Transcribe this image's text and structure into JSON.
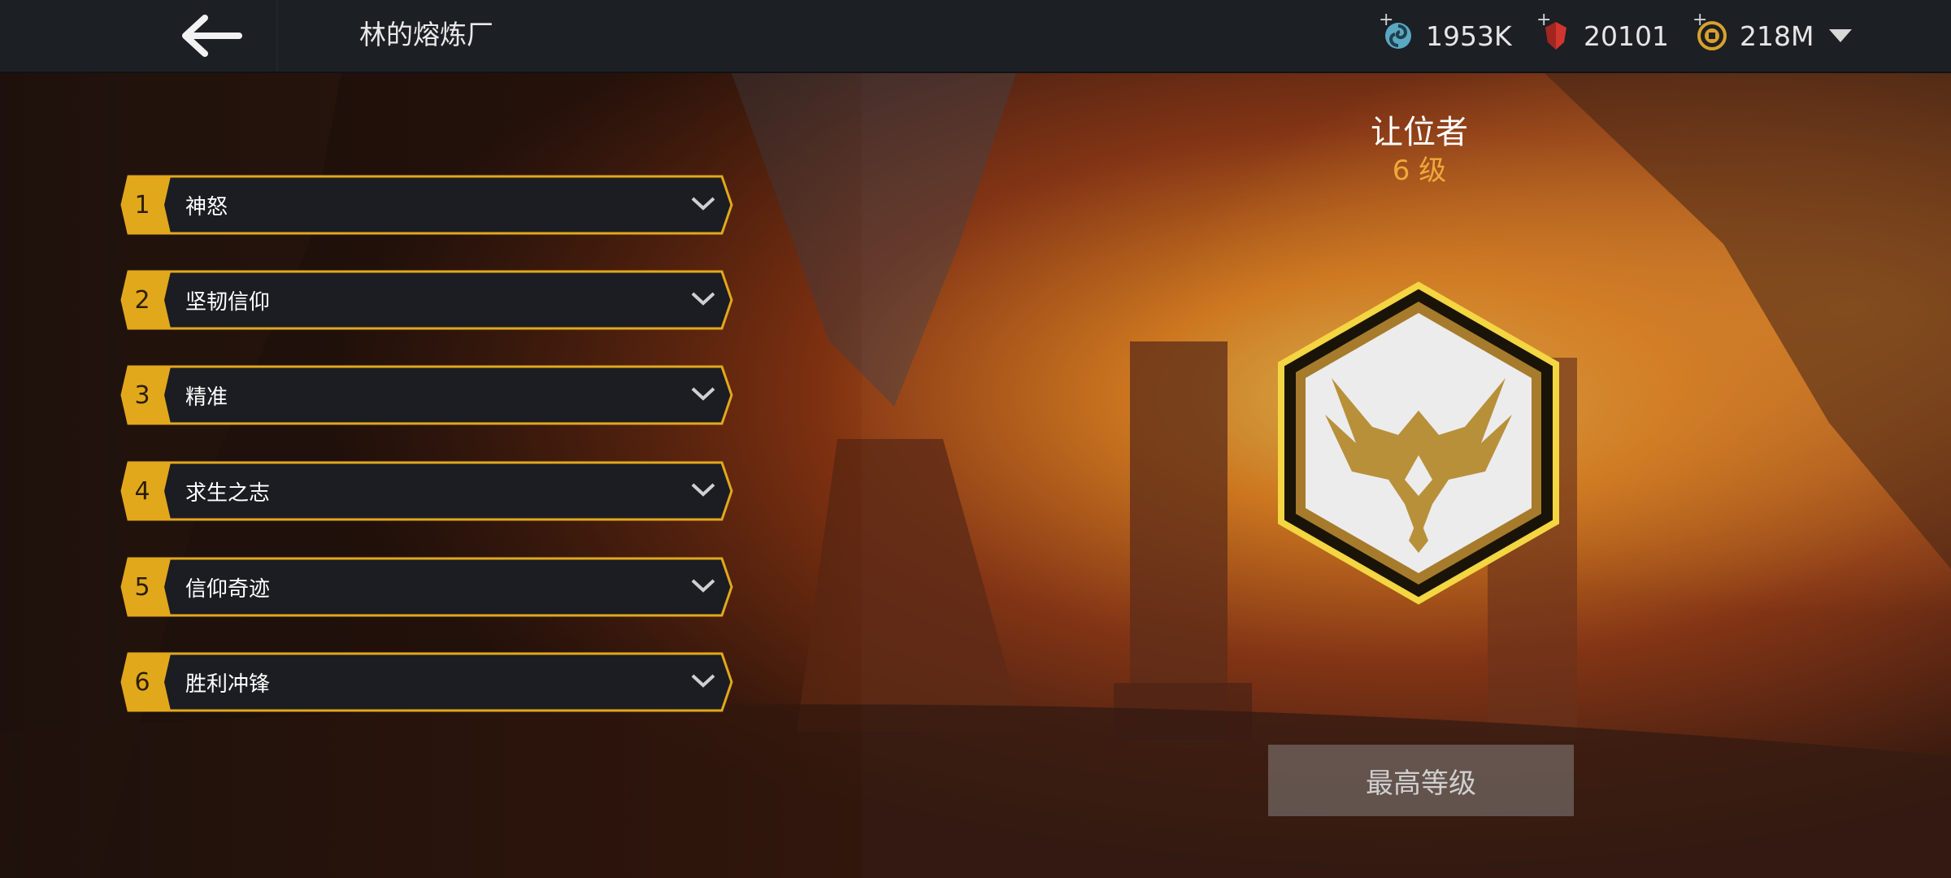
{
  "header": {
    "title": "林的熔炼厂",
    "resources": [
      {
        "icon": "energy-swirl-icon",
        "value": "1953K",
        "plus": "+"
      },
      {
        "icon": "red-gem-icon",
        "value": "20101",
        "plus": "+"
      },
      {
        "icon": "gold-coin-icon",
        "value": "218M",
        "plus": "+"
      }
    ]
  },
  "list": {
    "items": [
      {
        "num": "1",
        "label": "神怒"
      },
      {
        "num": "2",
        "label": "坚韧信仰"
      },
      {
        "num": "3",
        "label": "精准"
      },
      {
        "num": "4",
        "label": "求生之志"
      },
      {
        "num": "5",
        "label": "信仰奇迹"
      },
      {
        "num": "6",
        "label": "胜利冲锋"
      }
    ]
  },
  "detail": {
    "name": "让位者",
    "level": "6 级",
    "button": "最高等级",
    "badge_icon": "eagle-hexagon-badge-icon"
  },
  "colors": {
    "accent_gold": "#e2a81c",
    "level_orange": "#f0a93a",
    "topbar": "#1c1f24"
  }
}
